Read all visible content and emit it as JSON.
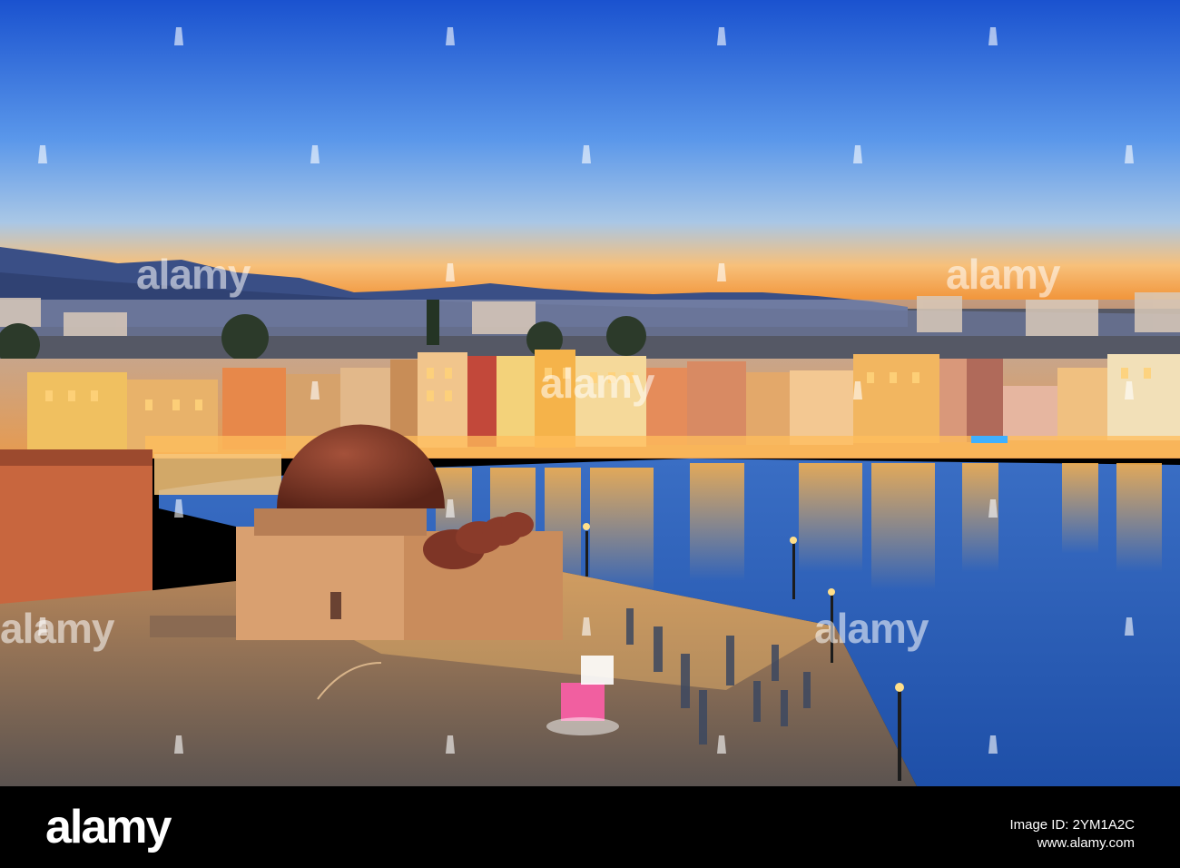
{
  "scene": {
    "description_colors": {
      "sky_top": "#1f5fd6",
      "sky_mid": "#6aa6f0",
      "sky_horizon": "#f49a3a",
      "mountains": "#3b4f86",
      "water": "#2c5fb8",
      "glow": "#ffb347",
      "mosque_dome": "#8a3b2a"
    }
  },
  "watermark": {
    "brand": "alamy"
  },
  "footer": {
    "brand": "alamy",
    "image_id": "Image ID: 2YM1A2C",
    "url": "www.alamy.com"
  }
}
